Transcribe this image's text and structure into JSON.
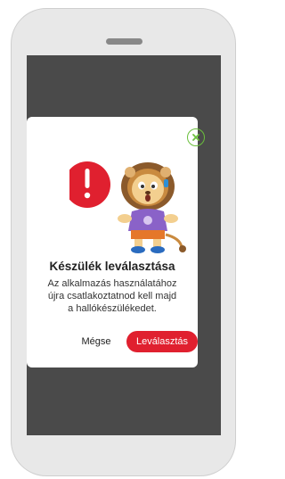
{
  "dialog": {
    "title": "Készülék leválasztása",
    "description_lines": [
      "Az alkalmazás használatához",
      "újra csatlakoztatnod kell majd",
      "a hallókészülékedet."
    ],
    "cancel_label": "Mégse",
    "confirm_label": "Leválasztás"
  },
  "icons": {
    "close": "close-icon",
    "warning": "warning-icon",
    "mascot": "lion-mascot"
  },
  "colors": {
    "accent_red": "#e0202f",
    "close_green": "#6abf3c",
    "overlay": "#4a4a4a"
  }
}
